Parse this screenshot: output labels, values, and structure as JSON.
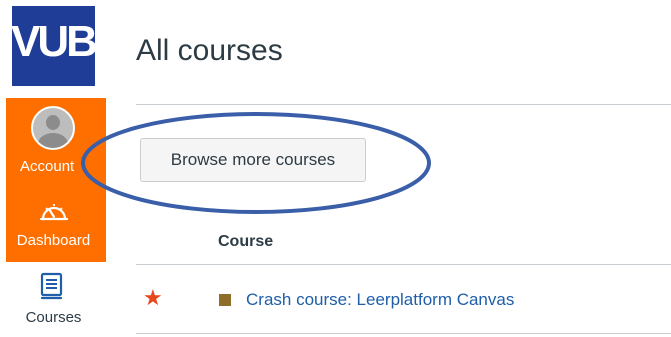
{
  "logo": {
    "text": "VUB"
  },
  "nav": {
    "items": [
      {
        "label": "Account",
        "icon": "account-avatar-icon"
      },
      {
        "label": "Dashboard",
        "icon": "dashboard-gauge-icon"
      },
      {
        "label": "Courses",
        "icon": "courses-book-icon"
      }
    ]
  },
  "main": {
    "title": "All courses",
    "browse_button_label": "Browse more courses",
    "table": {
      "column_header": "Course",
      "rows": [
        {
          "favorite": true,
          "color": "#8d6e2a",
          "name": "Crash course: Leerplatform Canvas"
        }
      ]
    }
  },
  "colors": {
    "nav_active": "#ff6f00",
    "logo_bg": "#1f3d96",
    "link": "#1f5ea8",
    "annotation_oval": "#3a5fa8",
    "star": "#e8461c"
  }
}
